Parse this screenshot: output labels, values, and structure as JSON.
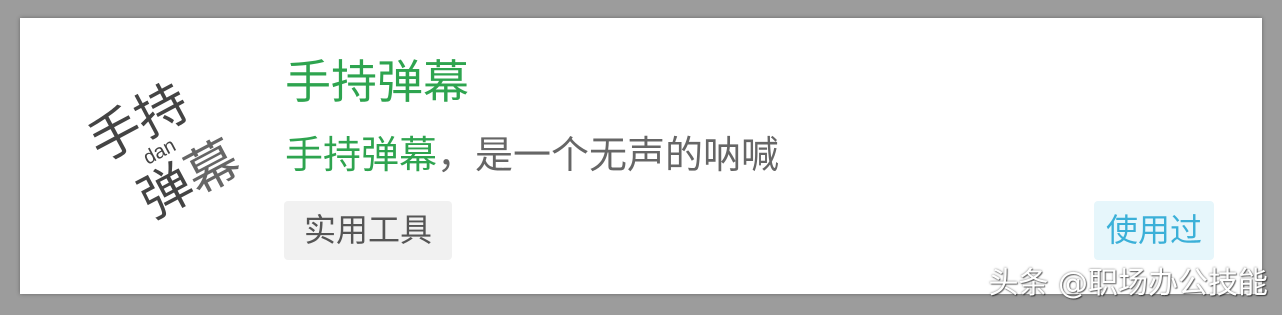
{
  "app": {
    "icon_name": "shouchi-danmu-logo",
    "icon_text_top": "手持",
    "icon_text_small": "dan",
    "icon_text_bottom_left": "弹",
    "icon_text_bottom_right": "幕",
    "title": "手持弹幕",
    "description_highlight": "手持弹幕",
    "description_rest": "，是一个无声的呐喊",
    "category_tag": "实用工具",
    "used_badge": "使用过"
  },
  "watermark": "头条 @职场办公技能",
  "colors": {
    "accent_green": "#2ea44f",
    "badge_blue": "#3bb0d8",
    "badge_bg": "#e6f6fb",
    "tag_bg": "#f1f1f1",
    "page_bg": "#9c9c9c"
  }
}
